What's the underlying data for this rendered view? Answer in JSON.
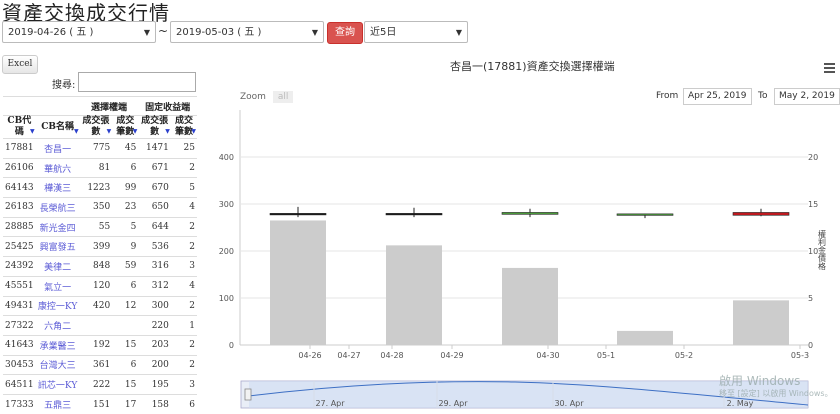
{
  "page": {
    "title": "資產交換成交行情"
  },
  "filters": {
    "from_date": "2019-04-26 ( 五 )",
    "separator": "~",
    "to_date": "2019-05-03 ( 五 )",
    "query_label": "查詢",
    "range": "近5日"
  },
  "toolbar": {
    "excel_label": "Excel",
    "search_label": "搜尋:"
  },
  "table": {
    "group_headers": [
      "選擇權端",
      "固定收益端"
    ],
    "columns": [
      "CB代碼",
      "CB名稱",
      "成交張數",
      "成交筆數",
      "成交張數",
      "成交筆數"
    ],
    "rows": [
      [
        "17881",
        "杏昌一",
        "775",
        "45",
        "1471",
        "25"
      ],
      [
        "26106",
        "華航六",
        "81",
        "6",
        "671",
        "2"
      ],
      [
        "64143",
        "樺漢三",
        "1223",
        "99",
        "670",
        "5"
      ],
      [
        "26183",
        "長榮航三",
        "350",
        "23",
        "650",
        "4"
      ],
      [
        "28885",
        "新光金四",
        "55",
        "5",
        "644",
        "2"
      ],
      [
        "25425",
        "興富發五",
        "399",
        "9",
        "536",
        "2"
      ],
      [
        "24392",
        "美律二",
        "848",
        "59",
        "316",
        "3"
      ],
      [
        "45551",
        "氣立一",
        "120",
        "6",
        "312",
        "4"
      ],
      [
        "49431",
        "康控一KY",
        "420",
        "12",
        "300",
        "2"
      ],
      [
        "27322",
        "六角二",
        "",
        "",
        "220",
        "1"
      ],
      [
        "41643",
        "承業醫三",
        "192",
        "15",
        "203",
        "2"
      ],
      [
        "30453",
        "台灣大三",
        "361",
        "6",
        "200",
        "2"
      ],
      [
        "64511",
        "訊芯一KY",
        "222",
        "15",
        "195",
        "3"
      ],
      [
        "17333",
        "五鼎三",
        "151",
        "17",
        "158",
        "6"
      ]
    ]
  },
  "chart": {
    "title": "杏昌一(17881)資產交換選擇權端",
    "zoom_label": "Zoom",
    "zoom_all": "all",
    "from_label": "From",
    "from_value": "Apr 25, 2019",
    "to_label": "To",
    "to_value": "May 2, 2019",
    "right_axis_label": "權利金價格",
    "navigator_labels": [
      "27. Apr",
      "29. Apr",
      "30. Apr",
      "2. May"
    ]
  },
  "chart_data": {
    "type": "bar",
    "x_ticks": [
      "04-26",
      "04-27",
      "04-28",
      "04-29",
      "04-30",
      "05-1",
      "05-2",
      "05-3"
    ],
    "categories": [
      "04-26",
      "04-28",
      "04-30",
      "05-2",
      "05-3"
    ],
    "volume": [
      265,
      212,
      164,
      30,
      95
    ],
    "left_axis": {
      "ticks": [
        0,
        100,
        200,
        300,
        400
      ],
      "ylim": [
        0,
        500
      ]
    },
    "right_axis": {
      "ticks": [
        0,
        5,
        10,
        15,
        20
      ],
      "ylim": [
        0,
        25
      ]
    },
    "candles": [
      {
        "open": 14.0,
        "high": 14.7,
        "low": 13.6,
        "close": 14.0,
        "color": "#111111"
      },
      {
        "open": 14.0,
        "high": 14.6,
        "low": 13.6,
        "close": 14.0,
        "color": "#111111"
      },
      {
        "open": 13.9,
        "high": 14.5,
        "low": 13.6,
        "close": 14.1,
        "color": "#4a9a3a"
      },
      {
        "open": 13.8,
        "high": 13.95,
        "low": 13.5,
        "close": 13.95,
        "color": "#4a9a3a"
      },
      {
        "open": 14.1,
        "high": 14.5,
        "low": 13.7,
        "close": 13.8,
        "color": "#c0191f"
      }
    ]
  },
  "watermark": {
    "line1": "啟用 Windows",
    "line2": "移至 [設定] 以啟用 Windows。"
  }
}
